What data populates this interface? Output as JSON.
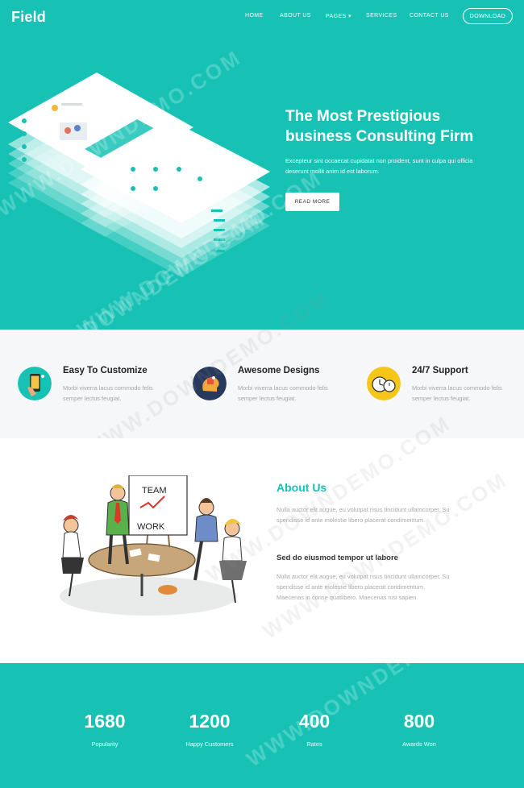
{
  "nav": {
    "logo": "Field",
    "items": [
      "HOME",
      "ABOUT US",
      "PAGES ▾",
      "SERVICES",
      "CONTACT US"
    ],
    "download": "DOWNLOAD"
  },
  "hero": {
    "title_line1": "The Most Prestigious",
    "title_line2": "business Consulting Firm",
    "text": "Excepteur sint occaecat cupidatat non proident, sunt in culpa qui officia deserunt mollit anim id est laborum.",
    "button": "READ MORE"
  },
  "features": [
    {
      "title": "Easy To Customize",
      "text": "Morbi viverra lacus commodo felis semper lectus feugiat.",
      "icon": "mobile-hand-icon"
    },
    {
      "title": "Awesome Designs",
      "text": "Morbi viverra lacus commodo felis semper lectus feugiat.",
      "icon": "puzzle-head-icon"
    },
    {
      "title": "24/7 Support",
      "text": "Morbi viverra lacus commodo felis semper lectus feugiat.",
      "icon": "clock-icon"
    }
  ],
  "about": {
    "title": "About Us",
    "text1": "Nulla auctor elit augue, eu volutpat risus tincidunt ullamcorper. Su spendisse id ante molestie libero placerat condimentum.",
    "subtitle": "Sed do eiusmod tempor ut labore",
    "text2": "Nulla auctor elit augue, eu volutpat risus tincidunt ullamcorper. Su spendisse id ante molestie libero placerat condimentum. Maecenas in conse quatlibero. Maecenas nisi sapien.",
    "board_top": "TEAM",
    "board_bottom": "WORK"
  },
  "stats": [
    {
      "value": "1680",
      "label": "Popularity"
    },
    {
      "value": "1200",
      "label": "Happy Customers"
    },
    {
      "value": "400",
      "label": "Rates"
    },
    {
      "value": "800",
      "label": "Awards Won"
    }
  ],
  "watermark": "WWW.DOWNDEMO.COM",
  "colors": {
    "brand": "#17c2b5",
    "light_bg": "#f5f7f8"
  }
}
